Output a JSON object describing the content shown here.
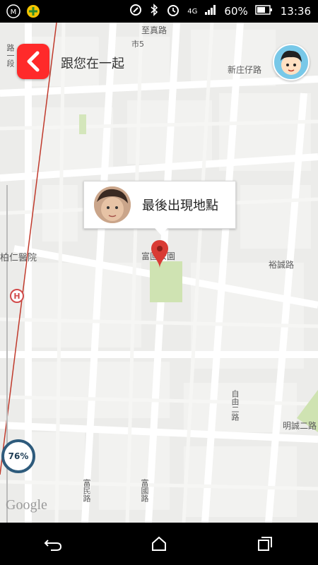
{
  "status_bar": {
    "network": "4G",
    "battery": "60%",
    "time": "13:36",
    "icons": [
      "m-app-icon",
      "plus-app-icon",
      "nfc-icon",
      "bluetooth-icon",
      "alarm-icon",
      "signal-icon",
      "battery-icon"
    ]
  },
  "header": {
    "back_icon": "chevron-left-icon",
    "title": "跟您在一起"
  },
  "bubble": {
    "text": "最後出現地點"
  },
  "map": {
    "labels": {
      "zhizhen_rd": "至真路",
      "shi5": "市5",
      "xinzhuang_rd": "新庄仔路",
      "ren_hospital": "柏仁醫院",
      "fuguo_park": "富國公園",
      "yucheng_rd": "裕誠路",
      "mingcheng_rd2": "明誠二路",
      "zishan_rd2": "自由二路",
      "fuguo_rd": "富國路",
      "fumin_rd": "富民路",
      "left_vertical": "路一段"
    },
    "battery_level": "76%",
    "attribution": "Google"
  },
  "nav_bar": {
    "back_icon": "back-icon",
    "home_icon": "home-icon",
    "recents_icon": "recents-icon"
  }
}
